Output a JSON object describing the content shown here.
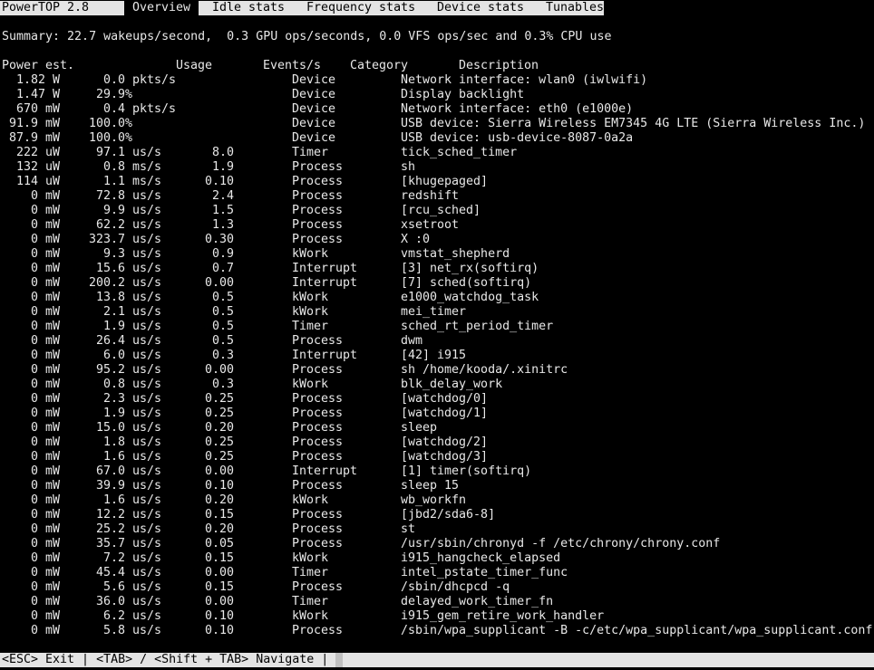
{
  "app": {
    "title": "PowerTOP 2.8"
  },
  "tabs": [
    {
      "label": "Overview",
      "active": true
    },
    {
      "label": "Idle stats",
      "active": false
    },
    {
      "label": "Frequency stats",
      "active": false
    },
    {
      "label": "Device stats",
      "active": false
    },
    {
      "label": "Tunables",
      "active": false
    }
  ],
  "summary": "Summary: 22.7 wakeups/second,  0.3 GPU ops/seconds, 0.0 VFS ops/sec and 0.3% CPU use",
  "columns": {
    "power": "Power est.",
    "usage": "Usage",
    "events": "Events/s",
    "category": "Category",
    "description": "Description"
  },
  "rows": [
    {
      "power": "1.82 W",
      "usage": "0.0 pkts/s",
      "events": "",
      "category": "Device",
      "description": "Network interface: wlan0 (iwlwifi)"
    },
    {
      "power": "1.47 W",
      "usage": "29.9%",
      "events": "",
      "category": "Device",
      "description": "Display backlight"
    },
    {
      "power": "670 mW",
      "usage": "0.4 pkts/s",
      "events": "",
      "category": "Device",
      "description": "Network interface: eth0 (e1000e)"
    },
    {
      "power": "91.9 mW",
      "usage": "100.0%",
      "events": "",
      "category": "Device",
      "description": "USB device: Sierra Wireless EM7345 4G LTE (Sierra Wireless Inc.)"
    },
    {
      "power": "87.9 mW",
      "usage": "100.0%",
      "events": "",
      "category": "Device",
      "description": "USB device: usb-device-8087-0a2a"
    },
    {
      "power": "222 uW",
      "usage": "97.1 us/s",
      "events": "8.0",
      "category": "Timer",
      "description": "tick_sched_timer"
    },
    {
      "power": "132 uW",
      "usage": "0.8 ms/s",
      "events": "1.9",
      "category": "Process",
      "description": "sh"
    },
    {
      "power": "114 uW",
      "usage": "1.1 ms/s",
      "events": "0.10",
      "category": "Process",
      "description": "[khugepaged]"
    },
    {
      "power": "0 mW",
      "usage": "72.8 us/s",
      "events": "2.4",
      "category": "Process",
      "description": "redshift"
    },
    {
      "power": "0 mW",
      "usage": "9.9 us/s",
      "events": "1.5",
      "category": "Process",
      "description": "[rcu_sched]"
    },
    {
      "power": "0 mW",
      "usage": "62.2 us/s",
      "events": "1.3",
      "category": "Process",
      "description": "xsetroot"
    },
    {
      "power": "0 mW",
      "usage": "323.7 us/s",
      "events": "0.30",
      "category": "Process",
      "description": "X :0"
    },
    {
      "power": "0 mW",
      "usage": "9.3 us/s",
      "events": "0.9",
      "category": "kWork",
      "description": "vmstat_shepherd"
    },
    {
      "power": "0 mW",
      "usage": "15.6 us/s",
      "events": "0.7",
      "category": "Interrupt",
      "description": "[3] net_rx(softirq)"
    },
    {
      "power": "0 mW",
      "usage": "200.2 us/s",
      "events": "0.00",
      "category": "Interrupt",
      "description": "[7] sched(softirq)"
    },
    {
      "power": "0 mW",
      "usage": "13.8 us/s",
      "events": "0.5",
      "category": "kWork",
      "description": "e1000_watchdog_task"
    },
    {
      "power": "0 mW",
      "usage": "2.1 us/s",
      "events": "0.5",
      "category": "kWork",
      "description": "mei_timer"
    },
    {
      "power": "0 mW",
      "usage": "1.9 us/s",
      "events": "0.5",
      "category": "Timer",
      "description": "sched_rt_period_timer"
    },
    {
      "power": "0 mW",
      "usage": "26.4 us/s",
      "events": "0.5",
      "category": "Process",
      "description": "dwm"
    },
    {
      "power": "0 mW",
      "usage": "6.0 us/s",
      "events": "0.3",
      "category": "Interrupt",
      "description": "[42] i915"
    },
    {
      "power": "0 mW",
      "usage": "95.2 us/s",
      "events": "0.00",
      "category": "Process",
      "description": "sh /home/kooda/.xinitrc"
    },
    {
      "power": "0 mW",
      "usage": "0.8 us/s",
      "events": "0.3",
      "category": "kWork",
      "description": "blk_delay_work"
    },
    {
      "power": "0 mW",
      "usage": "2.3 us/s",
      "events": "0.25",
      "category": "Process",
      "description": "[watchdog/0]"
    },
    {
      "power": "0 mW",
      "usage": "1.9 us/s",
      "events": "0.25",
      "category": "Process",
      "description": "[watchdog/1]"
    },
    {
      "power": "0 mW",
      "usage": "15.0 us/s",
      "events": "0.20",
      "category": "Process",
      "description": "sleep"
    },
    {
      "power": "0 mW",
      "usage": "1.8 us/s",
      "events": "0.25",
      "category": "Process",
      "description": "[watchdog/2]"
    },
    {
      "power": "0 mW",
      "usage": "1.6 us/s",
      "events": "0.25",
      "category": "Process",
      "description": "[watchdog/3]"
    },
    {
      "power": "0 mW",
      "usage": "67.0 us/s",
      "events": "0.00",
      "category": "Interrupt",
      "description": "[1] timer(softirq)"
    },
    {
      "power": "0 mW",
      "usage": "39.9 us/s",
      "events": "0.10",
      "category": "Process",
      "description": "sleep 15"
    },
    {
      "power": "0 mW",
      "usage": "1.6 us/s",
      "events": "0.20",
      "category": "kWork",
      "description": "wb_workfn"
    },
    {
      "power": "0 mW",
      "usage": "12.2 us/s",
      "events": "0.15",
      "category": "Process",
      "description": "[jbd2/sda6-8]"
    },
    {
      "power": "0 mW",
      "usage": "25.2 us/s",
      "events": "0.20",
      "category": "Process",
      "description": "st"
    },
    {
      "power": "0 mW",
      "usage": "35.7 us/s",
      "events": "0.05",
      "category": "Process",
      "description": "/usr/sbin/chronyd -f /etc/chrony/chrony.conf"
    },
    {
      "power": "0 mW",
      "usage": "7.2 us/s",
      "events": "0.15",
      "category": "kWork",
      "description": "i915_hangcheck_elapsed"
    },
    {
      "power": "0 mW",
      "usage": "45.4 us/s",
      "events": "0.00",
      "category": "Timer",
      "description": "intel_pstate_timer_func"
    },
    {
      "power": "0 mW",
      "usage": "5.6 us/s",
      "events": "0.15",
      "category": "Process",
      "description": "/sbin/dhcpcd -q"
    },
    {
      "power": "0 mW",
      "usage": "36.0 us/s",
      "events": "0.00",
      "category": "Timer",
      "description": "delayed_work_timer_fn"
    },
    {
      "power": "0 mW",
      "usage": "6.2 us/s",
      "events": "0.10",
      "category": "kWork",
      "description": "i915_gem_retire_work_handler"
    },
    {
      "power": "0 mW",
      "usage": "5.8 us/s",
      "events": "0.10",
      "category": "Process",
      "description": "/sbin/wpa_supplicant -B -c/etc/wpa_supplicant/wpa_supplicant.conf"
    }
  ],
  "footer": {
    "help": "<ESC> Exit | <TAB> / <Shift + TAB> Navigate |"
  }
}
